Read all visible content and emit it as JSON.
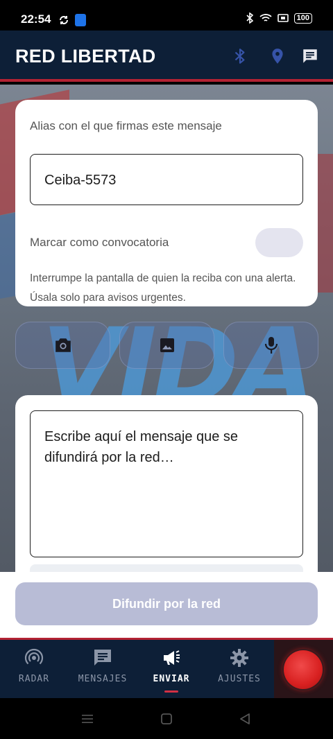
{
  "status_bar": {
    "time": "22:54",
    "battery": "100"
  },
  "header": {
    "title": "RED LIBERTAD",
    "icons": [
      "bluetooth-icon",
      "location-icon",
      "chat-icon"
    ]
  },
  "alias_card": {
    "label": "Alias con el que firmas este mensaje",
    "alias_value": "Ceiba-5573",
    "convocatoria_label": "Marcar como convocatoria",
    "convocatoria_enabled": false,
    "convocatoria_description": "Interrumpe la pantalla de quien la reciba con una alerta. Úsala solo para avisos urgentes."
  },
  "media_buttons": [
    "camera-icon",
    "image-icon",
    "microphone-icon"
  ],
  "message": {
    "placeholder": "Escribe aquí el mensaje que se difundirá por la red…"
  },
  "send_button": {
    "label": "Difundir por la red",
    "enabled": false
  },
  "bottom_nav": {
    "items": [
      {
        "label": "RADAR",
        "icon": "radar-icon"
      },
      {
        "label": "MENSAJES",
        "icon": "messages-icon"
      },
      {
        "label": "ENVIAR",
        "icon": "megaphone-icon"
      },
      {
        "label": "AJUSTES",
        "icon": "gear-icon"
      }
    ],
    "active": "ENVIAR"
  },
  "colors": {
    "primary_dark": "#0d1f37",
    "accent_red": "#b32233",
    "disabled_button": "#b8bcd6",
    "bluetooth_icon": "#3653a8"
  }
}
